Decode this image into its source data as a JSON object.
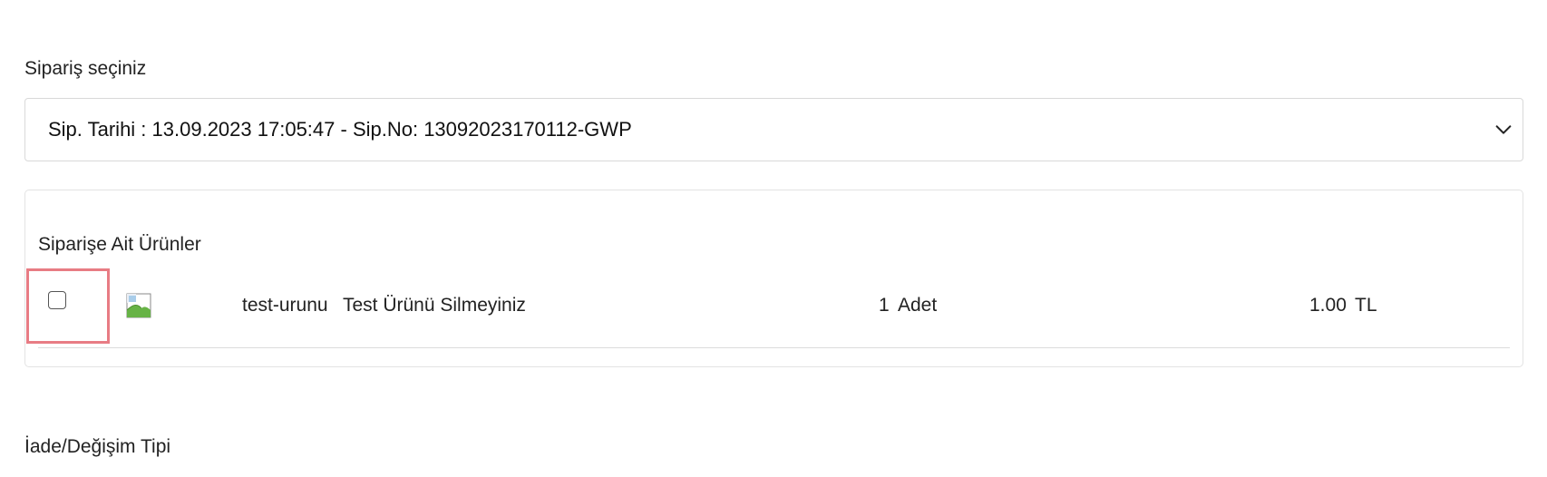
{
  "form": {
    "order_label": "Sipariş seçiniz",
    "order_select_value": "Sip. Tarihi : 13.09.2023 17:05:47 - Sip.No: 13092023170112-GWP",
    "return_type_label": "İade/Değişim Tipi"
  },
  "products_section": {
    "title": "Siparişe Ait Ürünler",
    "items": [
      {
        "checked": false,
        "image_icon": "broken-image-icon",
        "code": "test-urunu",
        "name": "Test Ürünü Silmeyiniz",
        "quantity": "1",
        "unit": "Adet",
        "price": "1.00",
        "currency": "TL"
      }
    ]
  },
  "colors": {
    "highlight": "#e87c84",
    "border": "#d9d9d9",
    "text": "#222222"
  },
  "icons": {
    "select_chevron": "chevron-down-icon"
  }
}
